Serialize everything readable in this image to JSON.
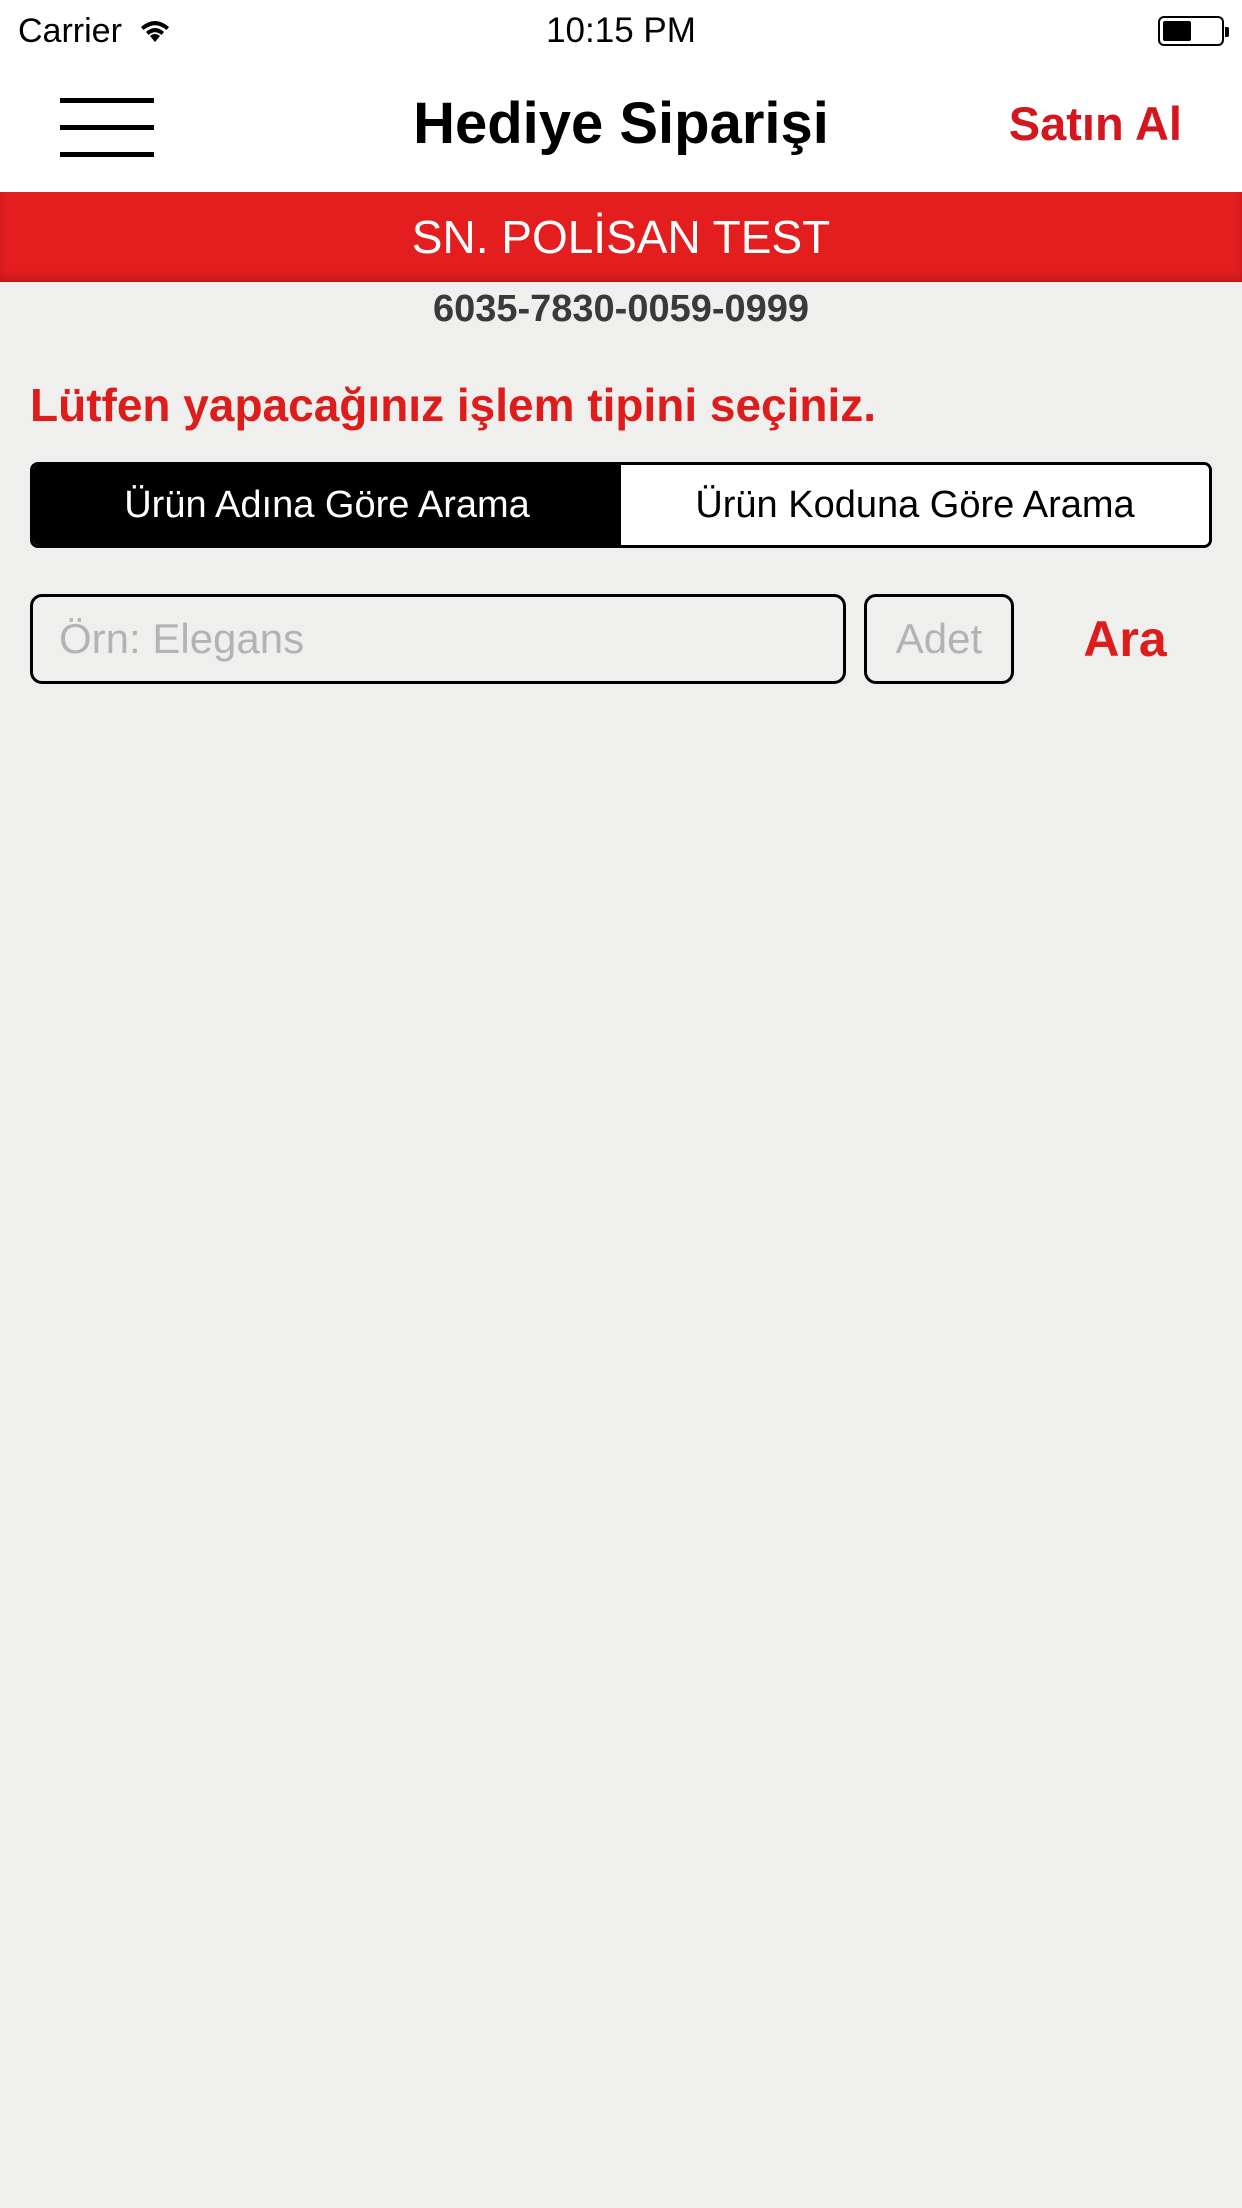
{
  "status_bar": {
    "carrier": "Carrier",
    "time": "10:15 PM",
    "battery_level": 0.5
  },
  "nav": {
    "title": "Hediye Siparişi",
    "action_label": "Satın Al",
    "menu_icon": "hamburger-icon"
  },
  "user": {
    "name": "SN. POLİSAN TEST",
    "card_number": "6035-7830-0059-0999"
  },
  "instruction": "Lütfen yapacağınız işlem tipini seçiniz.",
  "search_type": {
    "options": [
      "Ürün Adına Göre Arama",
      "Ürün Koduna Göre Arama"
    ],
    "selected": "Ürün Adına Göre Arama"
  },
  "search": {
    "product_placeholder": "Örn: Elegans",
    "product_value": "",
    "quantity_placeholder": "Adet",
    "quantity_value": "",
    "button_label": "Ara"
  },
  "colors": {
    "accent": "#e41e1e",
    "text_red": "#dd1c1c",
    "background": "#efefee"
  }
}
